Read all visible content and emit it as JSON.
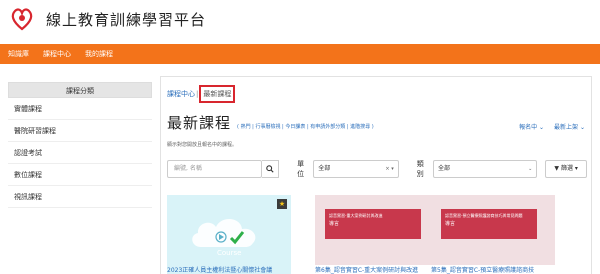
{
  "header": {
    "site_title": "線上教育訓練學習平台"
  },
  "nav": {
    "items": [
      {
        "label": "知識庫"
      },
      {
        "label": "課程中心"
      },
      {
        "label": "我的課程"
      }
    ]
  },
  "sidebar": {
    "heading": "課程分類",
    "items": [
      {
        "label": "實體課程"
      },
      {
        "label": "醫院研習課程"
      },
      {
        "label": "認證考試"
      },
      {
        "label": "數位課程"
      },
      {
        "label": "視訊課程"
      }
    ]
  },
  "breadcrumb": {
    "home": "課程中心",
    "separator": "|",
    "current": "最新課程"
  },
  "main": {
    "title": "最新課程",
    "filters": [
      "熱門",
      "行事曆檢視",
      "今日課表",
      "有申請外部分類",
      "進階搜尋"
    ],
    "sort_by": "報名中",
    "sort_order": "最新上架",
    "subtitle": "顯示對您開放且報名中的課程。",
    "search_placeholder": "編號, 名稱",
    "unit_label": "單位",
    "unit_value": "全部",
    "category_label": "類別",
    "category_value": "全部",
    "filter_button": "篩選"
  },
  "cards": [
    {
      "title": "2023正確人員主權利法暨心關懷社會議",
      "image_word": "Course"
    },
    {
      "title": "第6集_認音實習C-重大案例研討與改進",
      "banner_line1": "認音實習-重大案例研討與改進",
      "banner_line2": "導言"
    },
    {
      "title": "第5集_認音實習C-預立醫療照護諮商技",
      "banner_line1": "認音實習-預立醫療照護諮商技巧與常見問題",
      "banner_line2": "導言"
    }
  ],
  "colors": {
    "nav_bg": "#f3731a",
    "link": "#2a6ebb",
    "highlight_box": "#d8262e"
  }
}
